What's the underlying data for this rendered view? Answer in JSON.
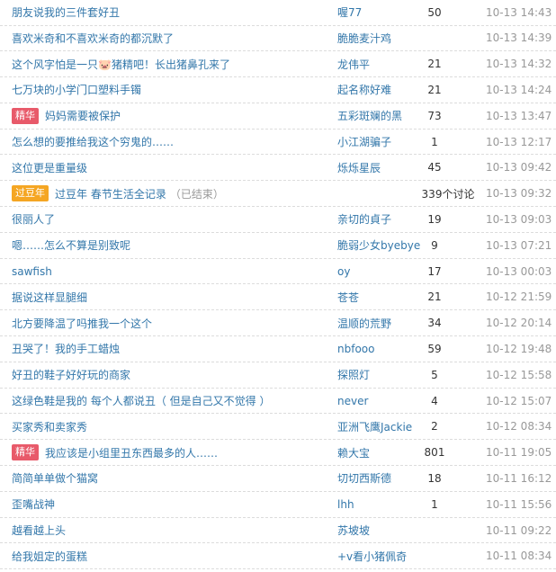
{
  "topics": [
    {
      "title": "朋友说我的三件套好丑",
      "author": "喔77",
      "replies": "50",
      "time": "10-13 14:43"
    },
    {
      "title": "喜欢米奇和不喜欢米奇的都沉默了",
      "author": "脆脆麦汁鸡",
      "replies": "",
      "time": "10-13 14:39"
    },
    {
      "title": "这个风字怕是一只🐷猪精吧！长出猪鼻孔来了",
      "author": "龙伟平",
      "replies": "21",
      "time": "10-13 14:32"
    },
    {
      "title": "七万块的小学门口塑料手镯",
      "author": "起名称好难",
      "replies": "21",
      "time": "10-13 14:24"
    },
    {
      "badge": "精华",
      "badge_type": "essence",
      "title": "妈妈需要被保护",
      "author": "五彩斑斓的黑",
      "replies": "73",
      "time": "10-13 13:47"
    },
    {
      "title": "怎么想的要推给我这个穷鬼的……",
      "author": "小江湖骗子",
      "replies": "1",
      "time": "10-13 12:17"
    },
    {
      "title": "这位更是重量级",
      "author": "烁烁星辰",
      "replies": "45",
      "time": "10-13 09:42"
    },
    {
      "badge": "过豆年",
      "badge_type": "event",
      "title": "过豆年 春节生活全记录",
      "note": "（已结束）",
      "author": "",
      "replies": "339个讨论",
      "time": "10-13 09:32"
    },
    {
      "title": "很丽人了",
      "author": "亲切的貞子",
      "replies": "19",
      "time": "10-13 09:03"
    },
    {
      "title": "嗯……怎么不算是别致呢",
      "author": "脆弱少女byebye",
      "replies": "9",
      "time": "10-13 07:21"
    },
    {
      "title": "sawfish",
      "author": "oy",
      "replies": "17",
      "time": "10-13 00:03"
    },
    {
      "title": "据说这样显腿细",
      "author": "苍苍",
      "replies": "21",
      "time": "10-12 21:59"
    },
    {
      "title": "北方要降温了吗推我一个这个",
      "author": "温顺的荒野",
      "replies": "34",
      "time": "10-12 20:14"
    },
    {
      "title": "丑哭了！我的手工蜡烛",
      "author": "nbfooo",
      "replies": "59",
      "time": "10-12 19:48"
    },
    {
      "title": "好丑的鞋子好好玩的商家",
      "author": "探照灯",
      "replies": "5",
      "time": "10-12 15:58"
    },
    {
      "title": "这绿色鞋是我的 每个人都说丑（ 但是自己又不觉得 ）",
      "author": "never",
      "replies": "4",
      "time": "10-12 15:07"
    },
    {
      "title": "买家秀和卖家秀",
      "author": "亚洲飞鹰Jackie",
      "replies": "2",
      "time": "10-12 08:34"
    },
    {
      "badge": "精华",
      "badge_type": "essence",
      "title": "我应该是小组里丑东西最多的人……",
      "author": "赖大宝",
      "replies": "801",
      "time": "10-11 19:05"
    },
    {
      "title": "简简单单做个猫窝",
      "author": "切切西斯德",
      "replies": "18",
      "time": "10-11 16:12"
    },
    {
      "title": "歪嘴战神",
      "author": "lhh",
      "replies": "1",
      "time": "10-11 15:56"
    },
    {
      "title": "越看越上头",
      "author": "苏坡坡",
      "replies": "",
      "time": "10-11 09:22"
    },
    {
      "title": "给我姐定的蛋糕",
      "author": "+v看小猪佩奇",
      "replies": "",
      "time": "10-11 08:34"
    }
  ]
}
